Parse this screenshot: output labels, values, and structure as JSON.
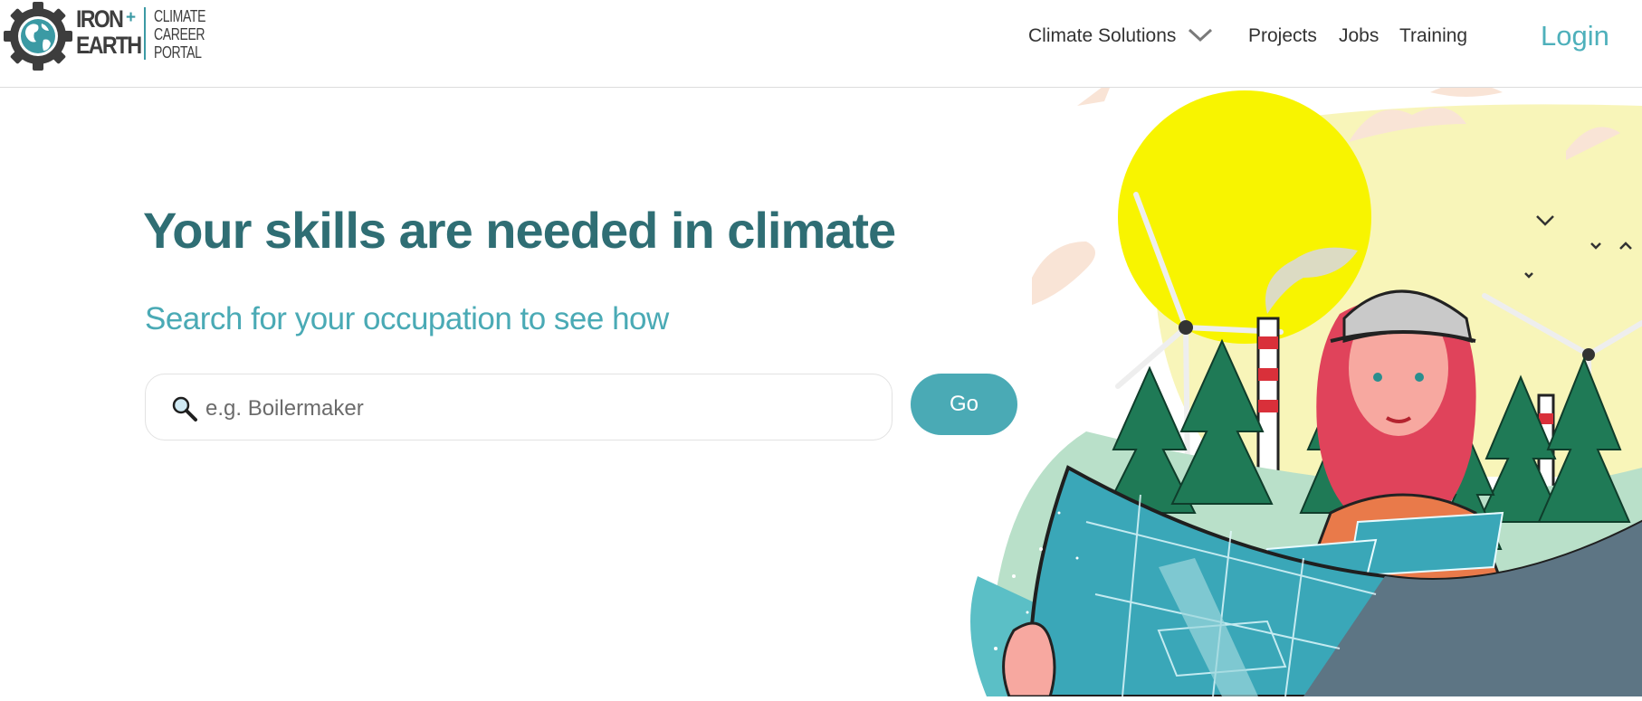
{
  "brand": {
    "name_line1": "IRON",
    "plus": "+",
    "name_line2": "EARTH",
    "subtitle_line1": "CLIMATE",
    "subtitle_line2": "CAREER",
    "subtitle_line3": "PORTAL",
    "logo_icon": "gear-globe-icon"
  },
  "nav": {
    "climate_solutions": "Climate Solutions",
    "dropdown_icon": "chevron-down-icon",
    "projects": "Projects",
    "jobs": "Jobs",
    "training": "Training",
    "login": "Login"
  },
  "hero": {
    "headline": "Your skills are needed in climate",
    "subheadline": "Search for your occupation to see how",
    "search": {
      "icon": "magnifier-icon",
      "placeholder": "e.g. Boilermaker",
      "value": ""
    },
    "go_label": "Go"
  },
  "colors": {
    "accent": "#4aaab5",
    "heading": "#2f6e74",
    "sun": "#f8f400",
    "forest": "#2e8b57",
    "solar_blue": "#3aa7b8"
  }
}
